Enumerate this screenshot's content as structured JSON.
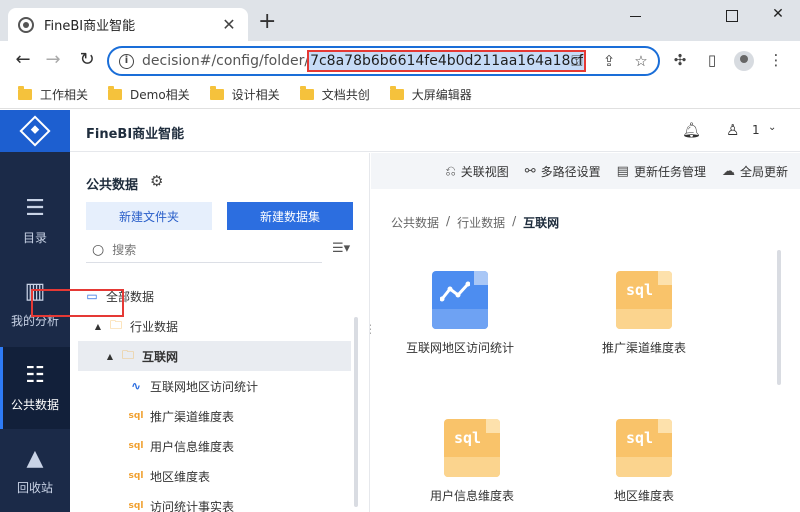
{
  "browser": {
    "tab_title": "FineBI商业智能",
    "tab_close": "✕",
    "new_tab": "+",
    "url_prefix": "decision#/config/folder/",
    "url_highlight": "7c8a78b6b6614fe4b0d211aa164a18cf",
    "bookmarks": [
      "工作相关",
      "Demo相关",
      "设计相关",
      "文档共创",
      "大屏编辑器"
    ]
  },
  "app": {
    "title": "FineBI商业智能",
    "user_name": "1",
    "nav": [
      {
        "label": "目录",
        "icon": "catalog-icon"
      },
      {
        "label": "我的分析",
        "icon": "analysis-icon"
      },
      {
        "label": "公共数据",
        "icon": "public-data-icon",
        "active": true
      },
      {
        "label": "回收站",
        "icon": "recycle-bin-icon"
      }
    ]
  },
  "tree_panel": {
    "title": "公共数据",
    "new_folder": "新建文件夹",
    "new_dataset": "新建数据集",
    "search_placeholder": "搜索",
    "items": [
      {
        "label": "全部数据",
        "type": "root"
      },
      {
        "label": "行业数据",
        "type": "folder"
      },
      {
        "label": "互联网",
        "type": "folder",
        "selected": true
      },
      {
        "label": "互联网地区访问统计",
        "type": "line"
      },
      {
        "label": "推广渠道维度表",
        "type": "sql"
      },
      {
        "label": "用户信息维度表",
        "type": "sql"
      },
      {
        "label": "地区维度表",
        "type": "sql"
      },
      {
        "label": "访问统计事实表",
        "type": "sql"
      }
    ]
  },
  "content": {
    "actions": [
      "关联视图",
      "多路径设置",
      "更新任务管理",
      "全局更新"
    ],
    "breadcrumb": [
      "公共数据",
      "/",
      "行业数据",
      "/",
      "互联网"
    ],
    "cards": [
      {
        "label": "互联网地区访问统计",
        "type": "line"
      },
      {
        "label": "推广渠道维度表",
        "type": "sql"
      },
      {
        "label": "用户信息维度表",
        "type": "sql"
      },
      {
        "label": "地区维度表",
        "type": "sql"
      }
    ],
    "sql_glyph": "sql"
  },
  "colors": {
    "accent": "#2c6ee0",
    "nav_bg": "#1b2a48",
    "highlight_border": "#e53935",
    "folder": "#f5a623"
  }
}
